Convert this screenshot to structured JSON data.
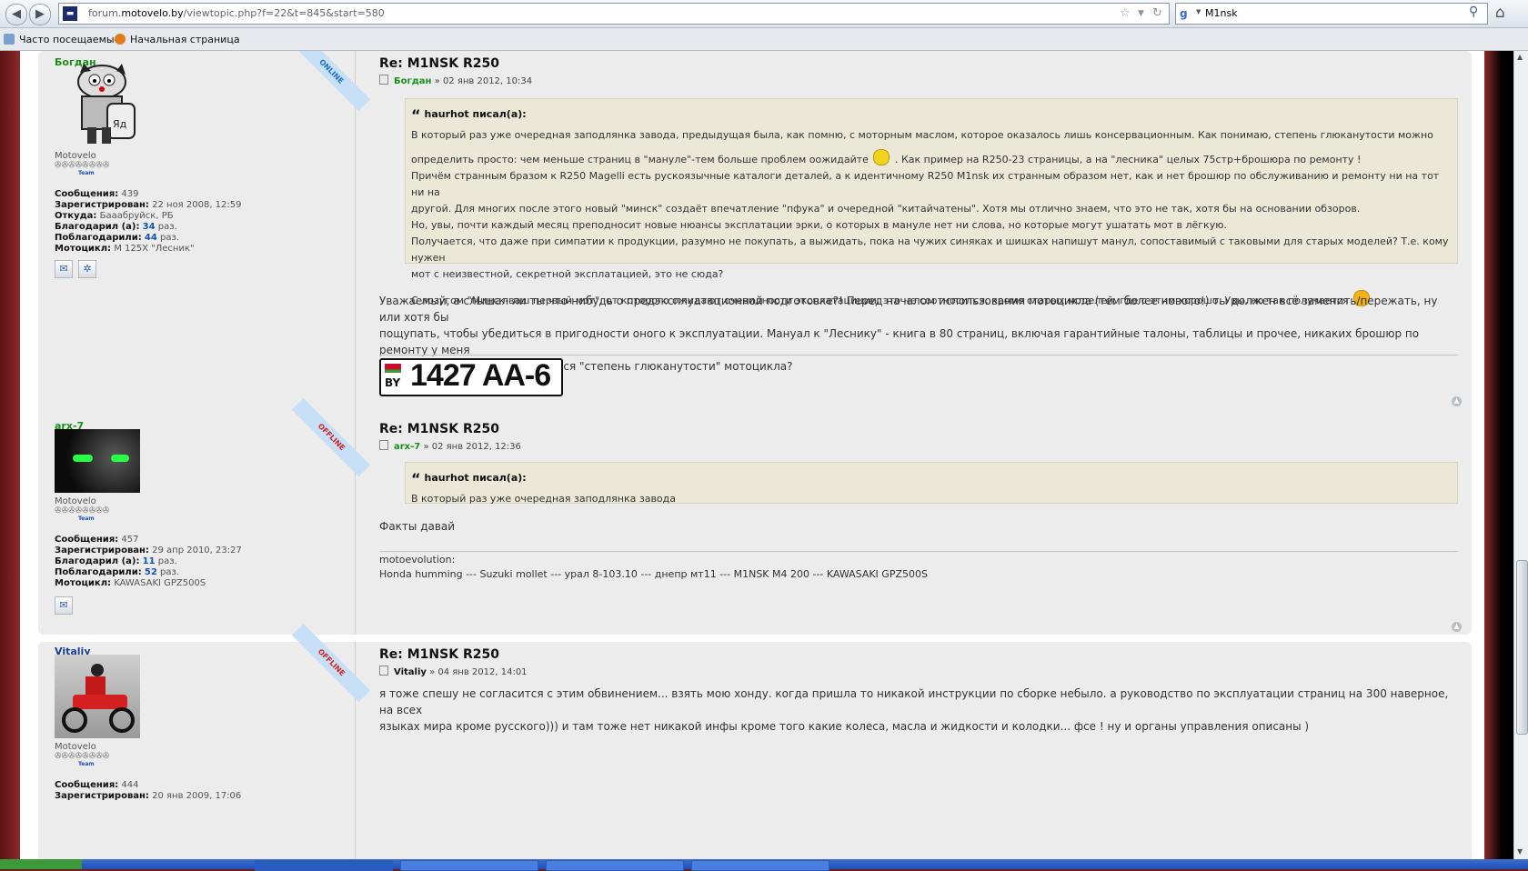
{
  "browser": {
    "url_prefix": "forum.",
    "url_domain": "motovelo.by",
    "url_path": "/viewtopic.php?f=22&t=845&start=580",
    "search_value": "M1nsk",
    "bookmarks": [
      "Часто посещаемые",
      "Начальная страница"
    ]
  },
  "posts": [
    {
      "author": "Богдан",
      "status": "ONLINE",
      "rank": "Motovelo",
      "stars": "✇✇✇✇✇✇✇✇",
      "team": "Team",
      "stats": [
        {
          "k": "Сообщения:",
          "v": "439"
        },
        {
          "k": "Зарегистрирован:",
          "v": "22 ноя 2008, 12:59"
        },
        {
          "k": "Откуда:",
          "v": "Бааабруйск, РБ"
        },
        {
          "k": "Благодарил (а):",
          "n": "34",
          "s": "раз."
        },
        {
          "k": "Поблагодарили:",
          "n": "44",
          "s": "раз."
        },
        {
          "k": "Мотоцикл:",
          "v": "М 125Х \"Лесник\""
        }
      ],
      "title": "Re: M1NSK R250",
      "meta_author": "Богдан",
      "meta_date": "» 02 янв 2012, 10:34",
      "quote_author": "haurhot писал(а):",
      "quote_lines": [
        "В который раз уже очередная заподлянка завода, предыдущая была, как помню, с моторным маслом, которое оказалось лишь консервационным. Как понимаю, степень глюканутости можно",
        "определить просто: чем меньше страниц в \"мануле\"-тем больше проблем оожидайте",
        ". Как пример на R250-23 страницы, а на \"лесника\" целых 75стр+брошюра по ремонту !",
        "Причём странным бразом к R250 Magelli есть рускоязычные каталоги деталей, а к идентичному R250 M1nsk их странным образом нет, как и нет брошюр по обслуживанию и ремонту ни на тот ни на",
        "другой. Для многих после этого новый \"минск\" создаёт впечатление \"пфука\" и очередной \"китайчатены\". Хотя мы отлично знаем, что это не так, хотя бы на основании обзоров.",
        "Но, увы, почти каждый месяц преподносит новые нюансы эксплатации эрки, о которых в мануле нет ни слова, но которые могут ушатать мот в лёгкую.",
        "Получается, что даже при симпатии к продукции, разумно не покупать, а выжидать, пока на чужих синяках и шишках напишут манул, сопоставимый с таковыми для старых моделей? Т.е. кому нужен",
        "мот с неизвестной, секретной эксплатацией, это не сюда?",
        "С лозугом \"Минск-ваш первый мот\", от которого ожидают очевидности эксплатациции, это не соотносится, кроме старых моделей, где с этим хорошо. Увы, но так получается"
      ],
      "body_lines": [
        "Уважаемый, а слышал ли ты что-нибудь о предэксплуатационной подготовке?! Перед началом использования мотоцикла (тем более нового!) ты должен всё заменить/пережать, ну или хотя бы",
        "пощупать, чтобы убедиться в пригодности оного к эксплуатации. Мануал к \"Леснику\" - книга в 80 страниц, включая гарантийные талоны, таблицы и прочее, никаких брошюр по ремонту у меня",
        "нет! haurhot, а в чём заключается \"степень глюканутости\" мотоцикла?"
      ],
      "plate": {
        "country": "BY",
        "number": "1427 AA-6"
      }
    },
    {
      "author": "arx-7",
      "status": "OFFLINE",
      "rank": "Motovelo",
      "stars": "✇✇✇✇✇✇✇✇",
      "team": "Team",
      "stats": [
        {
          "k": "Сообщения:",
          "v": "457"
        },
        {
          "k": "Зарегистрирован:",
          "v": "29 апр 2010, 23:27"
        },
        {
          "k": "Благодарил (а):",
          "n": "11",
          "s": "раз."
        },
        {
          "k": "Поблагодарили:",
          "n": "52",
          "s": "раз."
        },
        {
          "k": "Мотоцикл:",
          "v": "KAWASAKI GPZ500S"
        }
      ],
      "title": "Re: M1NSK R250",
      "meta_author": "arx-7",
      "meta_date": "» 02 янв 2012, 12:36",
      "quote_author": "haurhot писал(а):",
      "quote_text": "В который раз уже очередная заподлянка завода",
      "body": "Факты давай",
      "sig_label": "motoevolution:",
      "sig_text": "Honda humming --- Suzuki mollet --- урал 8-103.10 --- днепр мт11 --- M1NSK M4 200 --- KAWASAKI GPZ500S"
    },
    {
      "author": "Vitaliy",
      "status": "OFFLINE",
      "rank": "Motovelo",
      "stars": "✇✇✇✇✇✇✇✇",
      "team": "Team",
      "stats": [
        {
          "k": "Сообщения:",
          "v": "444"
        },
        {
          "k": "Зарегистрирован:",
          "v": "20 янв 2009, 17:06"
        }
      ],
      "title": "Re: M1NSK R250",
      "meta_author": "Vitaliy",
      "meta_date": "» 04 янв 2012, 14:01",
      "body_lines": [
        "я тоже спешу не согласится с этим обвинением... взять мою хонду. когда пришла то никакой инструкции по сборке небыло. а руководство по эксплуатации страниц на 300 наверное, на всех",
        "языках мира кроме русского))) и там тоже нет никакой инфы кроме того какие колеса, масла и жидкости и колодки... фсе ! ну и органы управления описаны )"
      ]
    }
  ],
  "icons": {
    "back": "back-arrow-icon",
    "forward": "forward-arrow-icon",
    "star": "bookmark-star-icon",
    "reload": "reload-icon",
    "search": "search-icon",
    "home": "home-icon",
    "mail": "mail-icon",
    "web": "website-icon",
    "top": "back-to-top-icon"
  },
  "colors": {
    "author_green": "#1a8f1a",
    "author_blue": "#1a3c8f",
    "background": "#741c1c",
    "post_bg": "#ececec",
    "quote_bg": "#ebe8d8"
  }
}
